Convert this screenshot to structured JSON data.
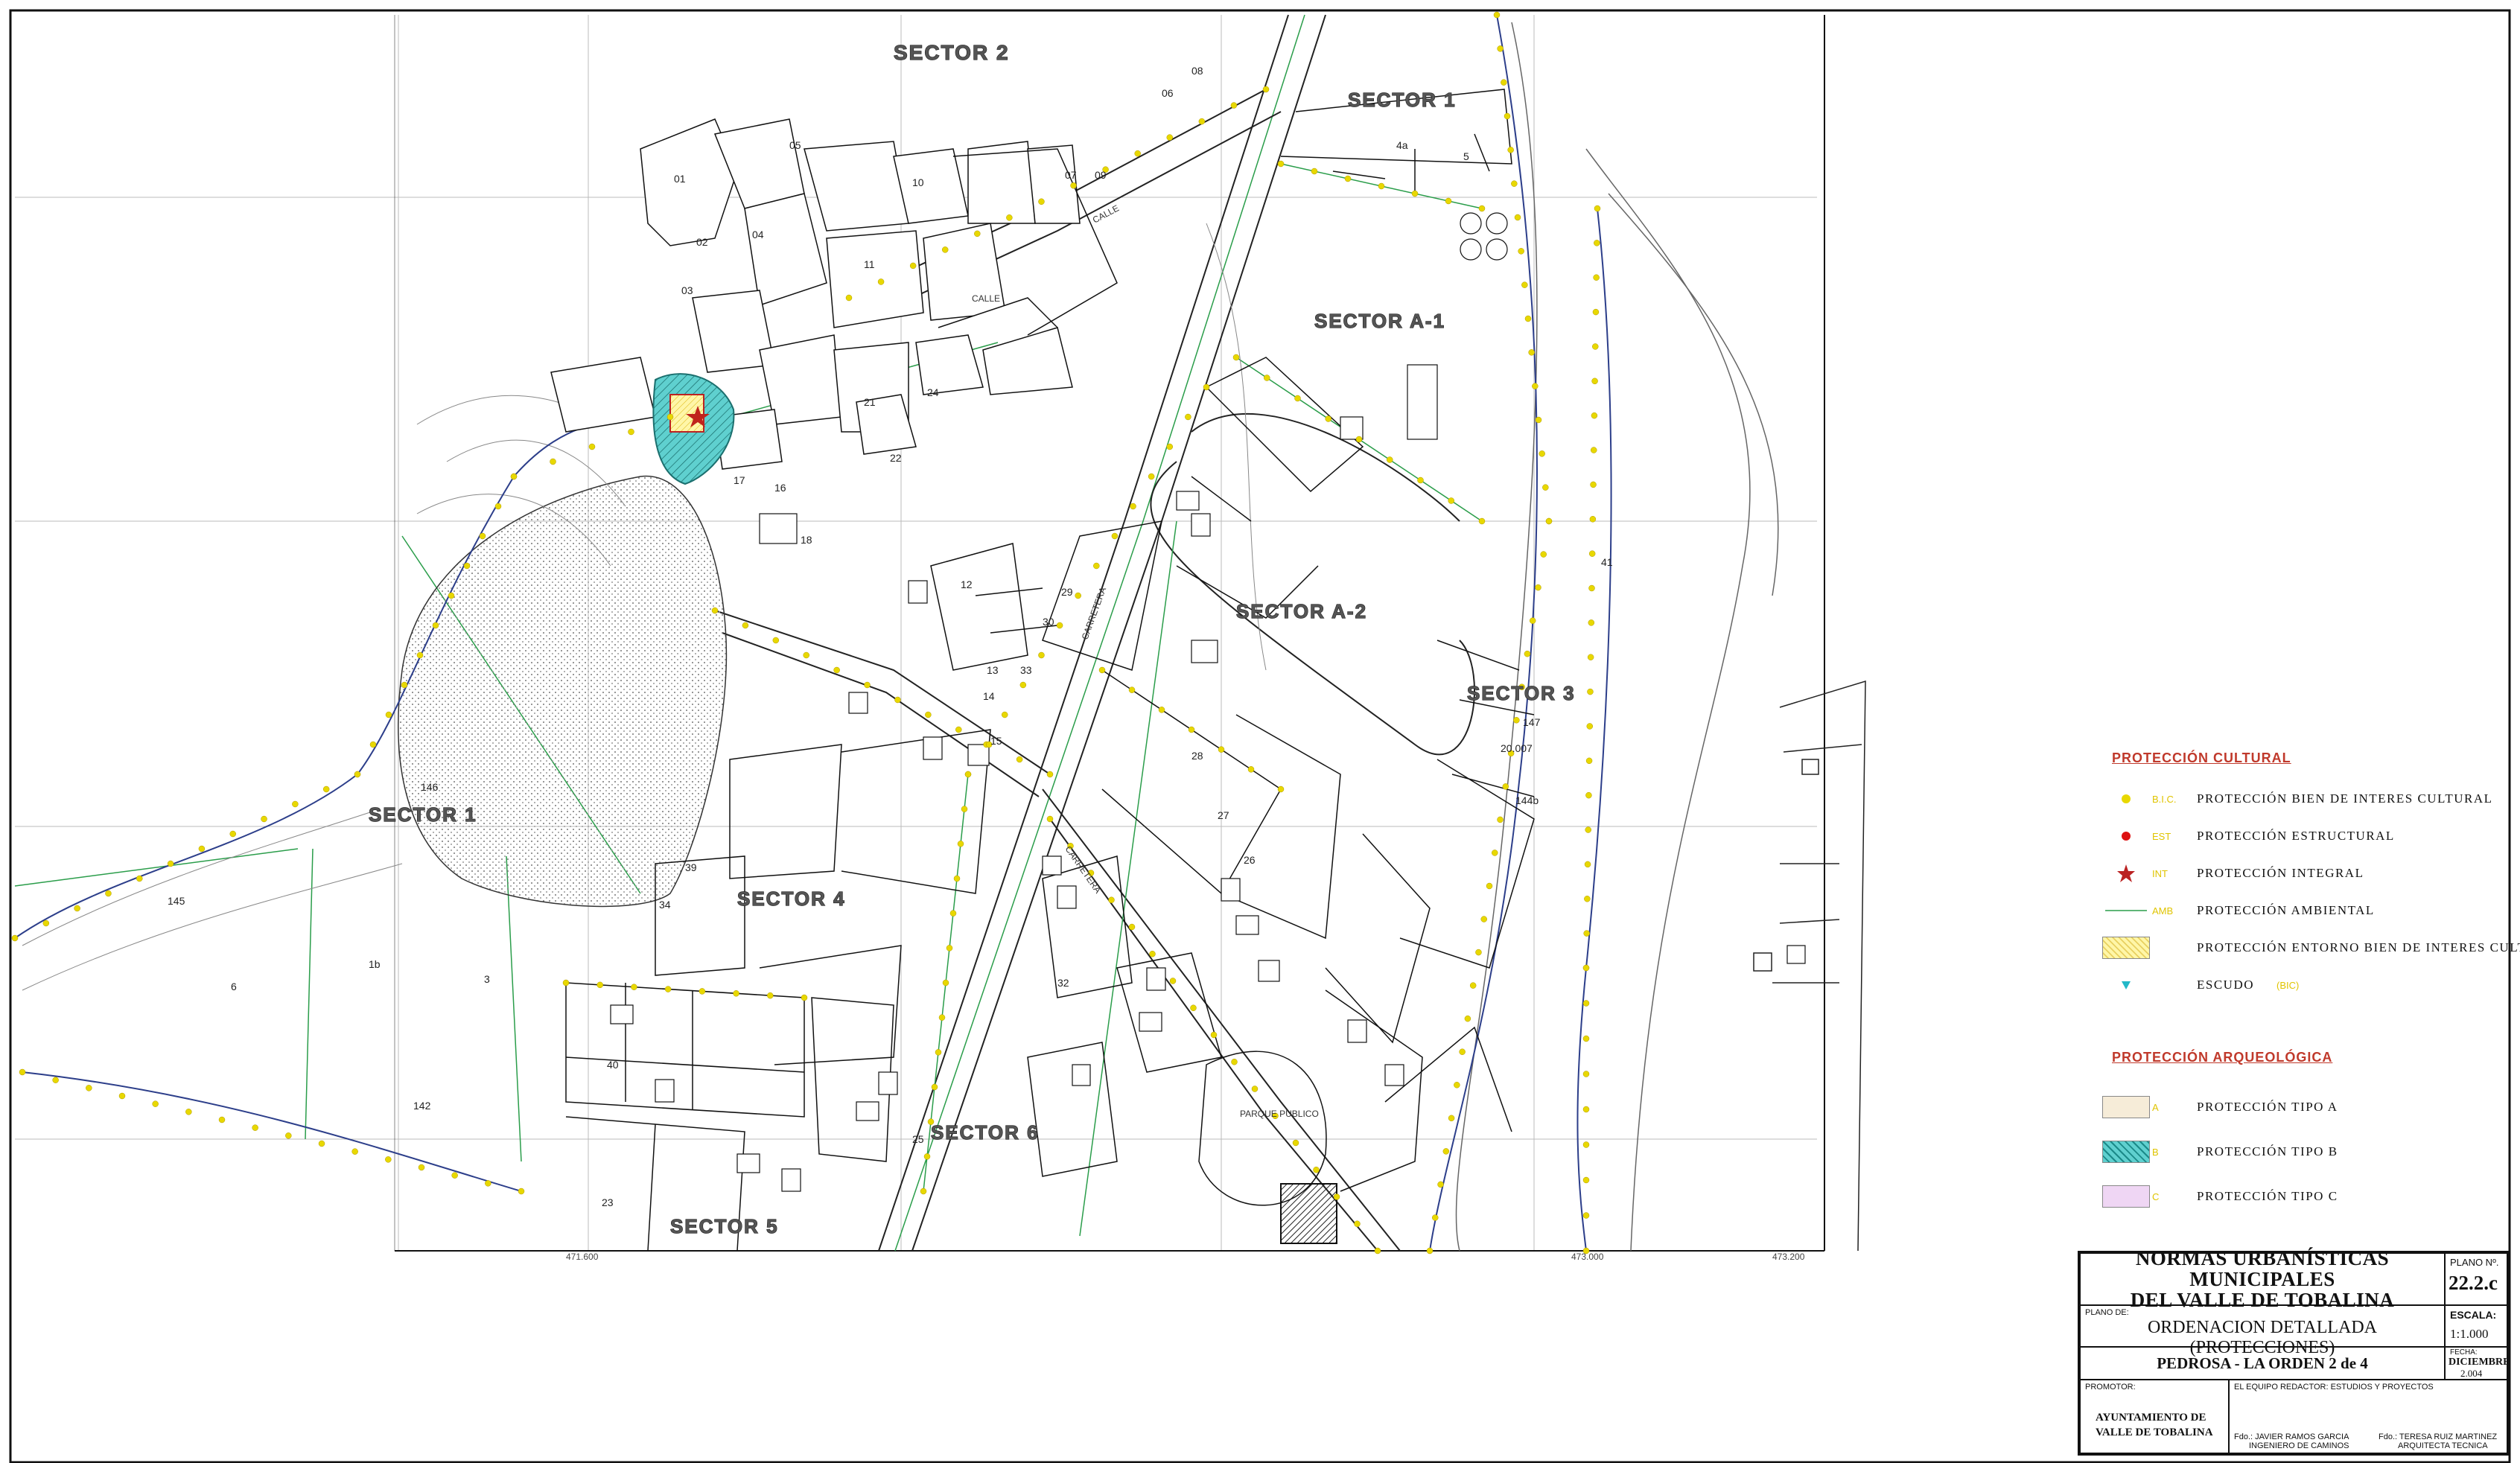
{
  "map": {
    "sectors": [
      {
        "id": "s2",
        "label": "SECTOR 2"
      },
      {
        "id": "s1a",
        "label": "SECTOR 1"
      },
      {
        "id": "sa1",
        "label": "SECTOR A-1"
      },
      {
        "id": "sa2",
        "label": "SECTOR A-2"
      },
      {
        "id": "s3",
        "label": "SECTOR 3"
      },
      {
        "id": "s1b",
        "label": "SECTOR 1"
      },
      {
        "id": "s4",
        "label": "SECTOR 4"
      },
      {
        "id": "s6",
        "label": "SECTOR 6"
      },
      {
        "id": "s5",
        "label": "SECTOR 5"
      }
    ],
    "plots": [
      "01",
      "02",
      "03",
      "04",
      "05",
      "06",
      "07",
      "08",
      "09",
      "10",
      "11",
      "12",
      "13",
      "14",
      "15",
      "16",
      "17",
      "18",
      "21",
      "22",
      "23",
      "24",
      "25",
      "26",
      "27",
      "28",
      "29",
      "30",
      "32",
      "33",
      "34",
      "39",
      "40",
      "4a",
      "5",
      "6",
      "1b",
      "3",
      "145",
      "146",
      "147",
      "144b",
      "20.007",
      "41",
      "142"
    ],
    "street_labels": [
      "CALLE",
      "CALLE",
      "CARRETERA",
      "CARRETERA",
      "PARQUE PUBLICO"
    ],
    "coords": [
      "471.600",
      "473.000",
      "473.200"
    ],
    "colors": {
      "cultural": "#e8d800",
      "structural": "#d11",
      "integral": "#b22",
      "environment": "#2a9d4a",
      "arch_a": "#f6ecd8",
      "arch_b": "#5fd0cf",
      "arch_c": "#efd6f4",
      "lot_line": "#2c3e8a"
    }
  },
  "legend": {
    "cultural_title": "PROTECCIÓN CULTURAL",
    "cultural": [
      {
        "code": "B.I.C.",
        "label": "PROTECCIÓN BIEN DE INTERES CULTURAL",
        "symbol": "dot-yellow"
      },
      {
        "code": "EST",
        "label": "PROTECCIÓN ESTRUCTURAL",
        "symbol": "dot-red"
      },
      {
        "code": "INT",
        "label": "PROTECCIÓN INTEGRAL",
        "symbol": "star-red"
      },
      {
        "code": "AMB",
        "label": "PROTECCIÓN AMBIENTAL",
        "symbol": "line-green"
      },
      {
        "code": "",
        "label": "PROTECCIÓN ENTORNO BIEN DE INTERES CULTURAL",
        "symbol": "hatch-yellow"
      },
      {
        "code": "(BIC)",
        "label": "ESCUDO",
        "symbol": "triangle-cyan"
      }
    ],
    "arch_title": "PROTECCIÓN ARQUEOLÓGICA",
    "arch": [
      {
        "code": "A",
        "label": "PROTECCIÓN TIPO A",
        "symbol": "swatch-a"
      },
      {
        "code": "B",
        "label": "PROTECCIÓN TIPO B",
        "symbol": "swatch-b"
      },
      {
        "code": "C",
        "label": "PROTECCIÓN TIPO C",
        "symbol": "swatch-c"
      }
    ]
  },
  "titleblock": {
    "main_title_1": "NORMAS URBANÍSTICAS MUNICIPALES",
    "main_title_2": "DEL VALLE DE TOBALINA",
    "plano_label": "PLANO Nº.",
    "plano_number": "22.2.c",
    "plano_de_label": "PLANO DE:",
    "plano_de": "ORDENACION DETALLADA (PROTECCIONES)",
    "escala_label": "ESCALA:",
    "escala": "1:1.000",
    "subtitle": "PEDROSA - LA ORDEN 2 de 4",
    "fecha_label": "FECHA:",
    "fecha_1": "DICIEMBRE",
    "fecha_2": "2.004",
    "promotor_label": "PROMOTOR:",
    "promotor_1": "AYUNTAMIENTO DE",
    "promotor_2": "VALLE DE TOBALINA",
    "equipo_label": "EL EQUIPO REDACTOR: ESTUDIOS Y PROYECTOS",
    "firma1_1": "Fdo.: JAVIER RAMOS GARCIA",
    "firma1_2": "INGENIERO DE CAMINOS",
    "firma2_1": "Fdo.: TERESA RUIZ MARTINEZ",
    "firma2_2": "ARQUITECTA TECNICA"
  }
}
